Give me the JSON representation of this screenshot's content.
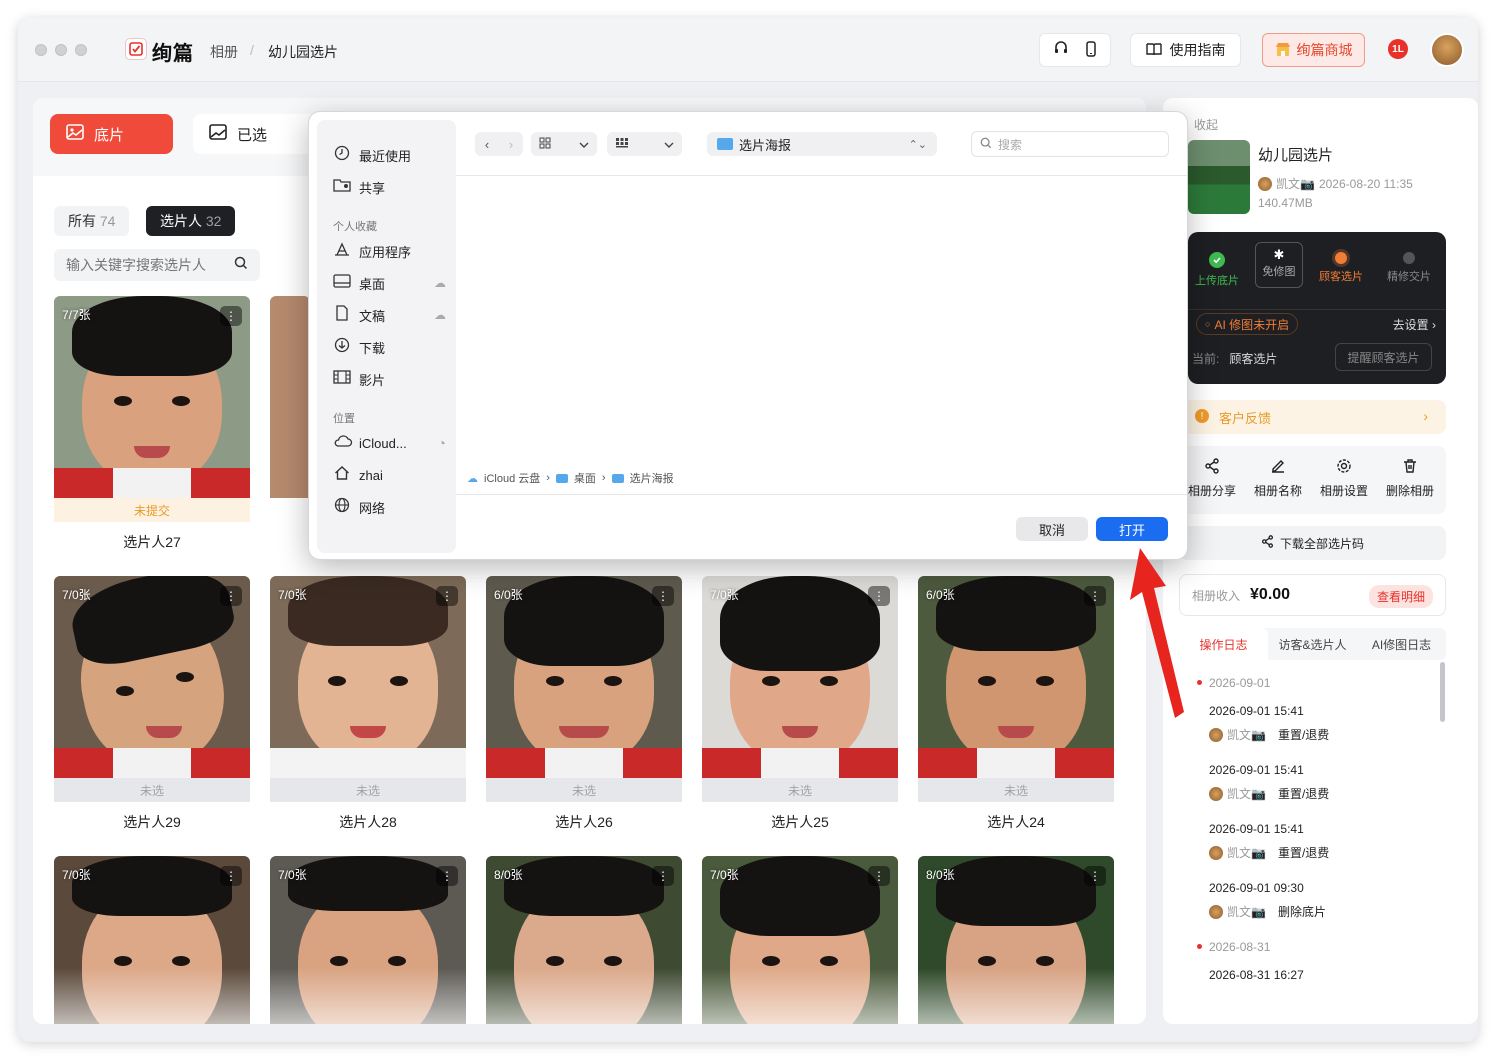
{
  "app": {
    "name": "绚篇",
    "breadcrumb": [
      "相册",
      "/",
      "幼儿园选片"
    ]
  },
  "toolbar": {
    "guide_label": "使用指南",
    "mall_label": "绚篇商城",
    "notif_badge": "1L"
  },
  "main_tabs": [
    {
      "label": "底片",
      "active": true
    },
    {
      "label": "已选",
      "active": false
    }
  ],
  "filters": [
    {
      "label": "所有",
      "count": "74"
    },
    {
      "label": "选片人",
      "count": "32"
    }
  ],
  "search": {
    "placeholder": "输入关键字搜索选片人"
  },
  "cards": [
    {
      "count": "7/7张",
      "status": "未提交",
      "name": "选片人27"
    },
    {
      "count": "7/0张",
      "status": "未选",
      "name": "选片人29"
    },
    {
      "count": "7/0张",
      "status": "未选",
      "name": "选片人28"
    },
    {
      "count": "6/0张",
      "status": "未选",
      "name": "选片人26"
    },
    {
      "count": "7/0张",
      "status": "未选",
      "name": "选片人25"
    },
    {
      "count": "6/0张",
      "status": "未选",
      "name": "选片人24"
    },
    {
      "count": "7/0张"
    },
    {
      "count": "7/0张"
    },
    {
      "count": "8/0张"
    },
    {
      "count": "7/0张"
    },
    {
      "count": "8/0张"
    }
  ],
  "more_icon": "⋮",
  "dialog": {
    "sidebar": {
      "recent": "最近使用",
      "shared": "共享",
      "favorites_head": "个人收藏",
      "applications": "应用程序",
      "desktop": "桌面",
      "documents": "文稿",
      "downloads": "下载",
      "movies": "影片",
      "locations_head": "位置",
      "icloud": "iCloud...",
      "home": "zhai",
      "network": "网络"
    },
    "current_folder": "选片海报",
    "search_placeholder": "搜索",
    "path": [
      "iCloud 云盘",
      "桌面",
      "选片海报"
    ],
    "cancel": "取消",
    "open": "打开"
  },
  "album": {
    "collapse": "收起",
    "title": "幼儿园选片",
    "owner": "凯文📷",
    "datetime": "2026-08-20 11:35",
    "size": "140.47MB"
  },
  "workflow": {
    "steps": [
      {
        "label": "上传底片",
        "color": "#3fb950"
      },
      {
        "label": "免修图",
        "color": "#ffffff"
      },
      {
        "label": "顾客选片",
        "color": "#f07d36"
      },
      {
        "label": "精修交片",
        "color": "#555555"
      }
    ],
    "ai_status": "AI 修图未开启",
    "go_settings": "去设置 ›",
    "current_label": "当前:",
    "current_value": "顾客选片",
    "remind": "提醒顾客选片"
  },
  "feedback": "客户反馈",
  "actions": [
    "相册分享",
    "相册名称",
    "相册设置",
    "删除相册"
  ],
  "download_all": "下载全部选片码",
  "income": {
    "label": "相册收入",
    "value": "¥0.00",
    "detail": "查看明细"
  },
  "log_tabs": [
    "操作日志",
    "访客&选片人",
    "AI修图日志"
  ],
  "logs": [
    {
      "date": "2026-09-01"
    },
    {
      "time": "2026-09-01 15:41",
      "user": "凯文📷",
      "action": "重置/退费"
    },
    {
      "time": "2026-09-01 15:41",
      "user": "凯文📷",
      "action": "重置/退费"
    },
    {
      "time": "2026-09-01 15:41",
      "user": "凯文📷",
      "action": "重置/退费"
    },
    {
      "time": "2026-09-01 09:30",
      "user": "凯文📷",
      "action": "删除底片"
    },
    {
      "date": "2026-08-31"
    },
    {
      "time": "2026-08-31 16:27"
    }
  ],
  "colors": {
    "accent": "#f04a3a",
    "open_button": "#1a6cf0",
    "annotation_arrow": "#e8241e"
  }
}
